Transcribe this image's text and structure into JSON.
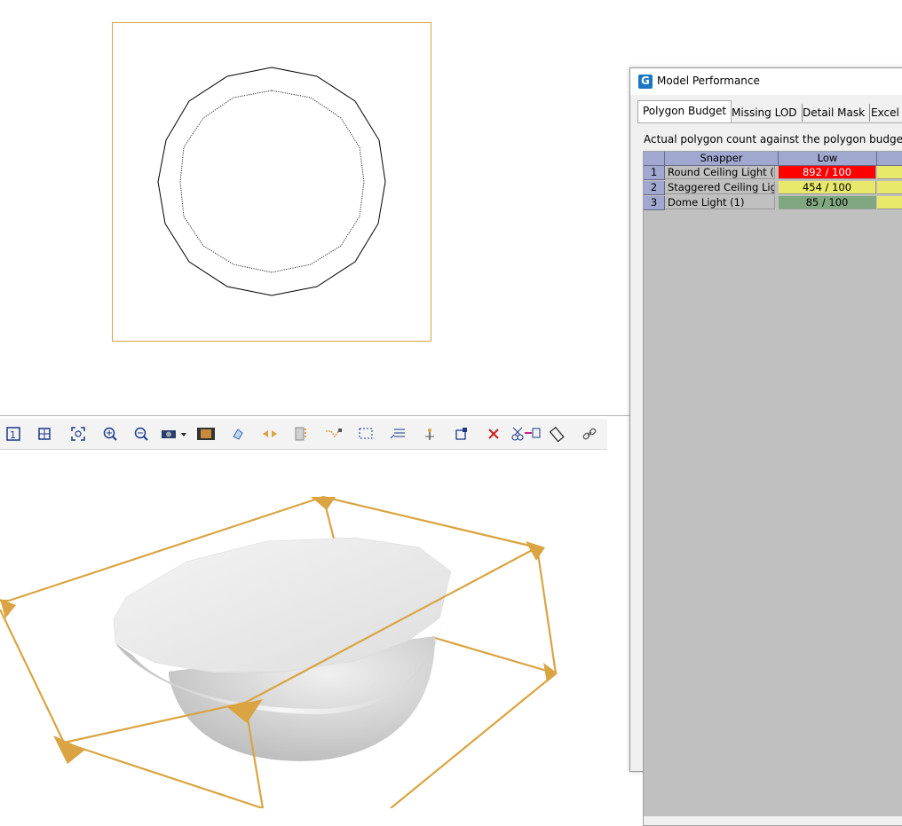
{
  "viewports": {
    "top": {
      "name": "top-orthographic-view"
    },
    "perspective": {
      "name": "perspective-view"
    }
  },
  "toolbar": {
    "buttons": [
      {
        "id": "zoom-extents-all",
        "icon": "zoom-extents-all-icon"
      },
      {
        "id": "zoom-extents",
        "icon": "zoom-extents-icon"
      },
      {
        "id": "zoom-fit",
        "icon": "zoom-fit-icon"
      },
      {
        "id": "zoom-in",
        "icon": "zoom-in-icon"
      },
      {
        "id": "zoom-out",
        "icon": "zoom-out-icon"
      },
      {
        "id": "camera",
        "icon": "camera-dropdown-icon"
      },
      {
        "id": "filmstrip",
        "icon": "filmstrip-icon"
      },
      {
        "id": "rotate",
        "icon": "rotate-icon"
      },
      {
        "id": "horizontal-move",
        "icon": "horizontal-arrows-icon"
      },
      {
        "id": "vertical-bars",
        "icon": "vertical-bars-icon"
      },
      {
        "id": "path",
        "icon": "path-icon"
      },
      {
        "id": "select-region",
        "icon": "select-region-icon"
      },
      {
        "id": "comment",
        "icon": "comment-icon"
      },
      {
        "id": "pivot",
        "icon": "pivot-icon"
      },
      {
        "id": "scale",
        "icon": "scale-icon"
      },
      {
        "id": "delete",
        "icon": "delete-x-icon"
      },
      {
        "id": "cut",
        "icon": "cut-icon"
      },
      {
        "id": "measure",
        "icon": "ruler-icon"
      },
      {
        "id": "link",
        "icon": "link-icon"
      }
    ]
  },
  "performance_window": {
    "title": "Model Performance",
    "tabs": [
      "Polygon Budget",
      "Missing LOD",
      "Detail Mask",
      "Excel"
    ],
    "active_tab": "Polygon Budget",
    "description": "Actual polygon count against the polygon budget (a",
    "columns": [
      "Snapper",
      "Low"
    ],
    "rows": [
      {
        "num": "1",
        "name": "Round Ceiling Light (",
        "low": "892 / 100",
        "low_color": "#ff0000",
        "low_text_color": "#ffffff",
        "next_color": "#e8e86a"
      },
      {
        "num": "2",
        "name": "Staggered Ceiling Lig",
        "low": "454 / 100",
        "low_color": "#e8e86a",
        "low_text_color": "#000000",
        "next_color": "#e8e86a"
      },
      {
        "num": "3",
        "name": "Dome Light (1)",
        "low": "85 / 100",
        "low_color": "#80a880",
        "low_text_color": "#000000",
        "next_color": "#e8e86a"
      }
    ]
  },
  "colors": {
    "selection_box": "#d9a441",
    "grid_background": "#c0c0c0",
    "header_blue": "#a0a8d0"
  }
}
